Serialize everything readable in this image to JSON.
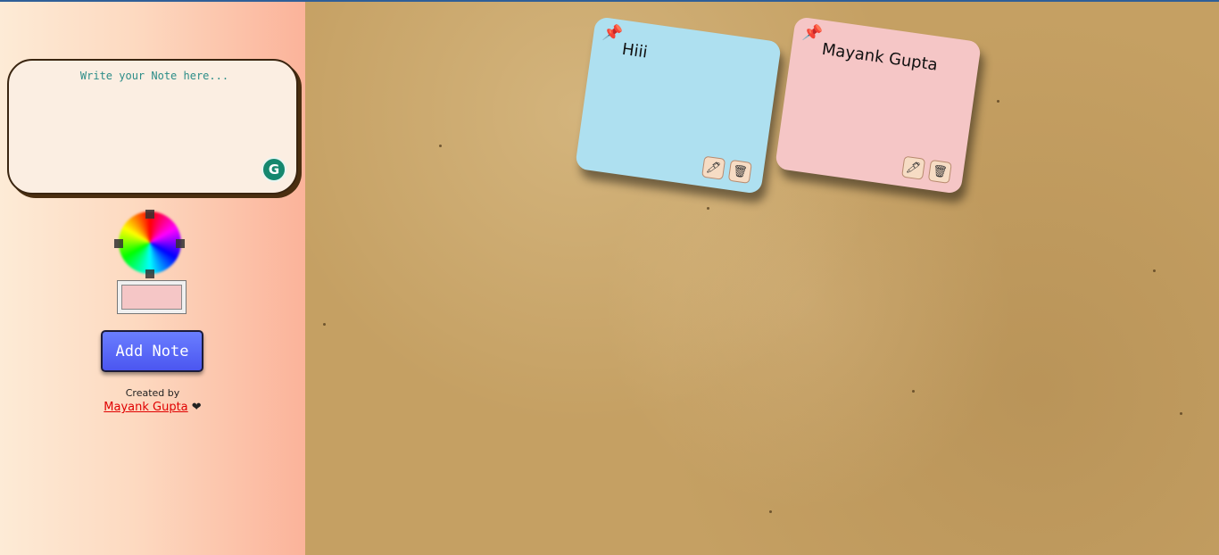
{
  "sidebar": {
    "note_placeholder": "Write your Note here...",
    "grammarly_icon": "G",
    "selected_color": "#f5c6c6",
    "add_button_label": "Add Note",
    "credit_label": "Created by",
    "author_link": "Mayank Gupta",
    "heart": "❤"
  },
  "notes": [
    {
      "text": "Hiii",
      "color": "#aee0f0",
      "pin_icon": "📌",
      "edit_icon": "🖊",
      "delete_icon": "🗑"
    },
    {
      "text": "Mayank Gupta",
      "color": "#f5c6c6",
      "pin_icon": "📌",
      "edit_icon": "🖊",
      "delete_icon": "🗑"
    }
  ]
}
